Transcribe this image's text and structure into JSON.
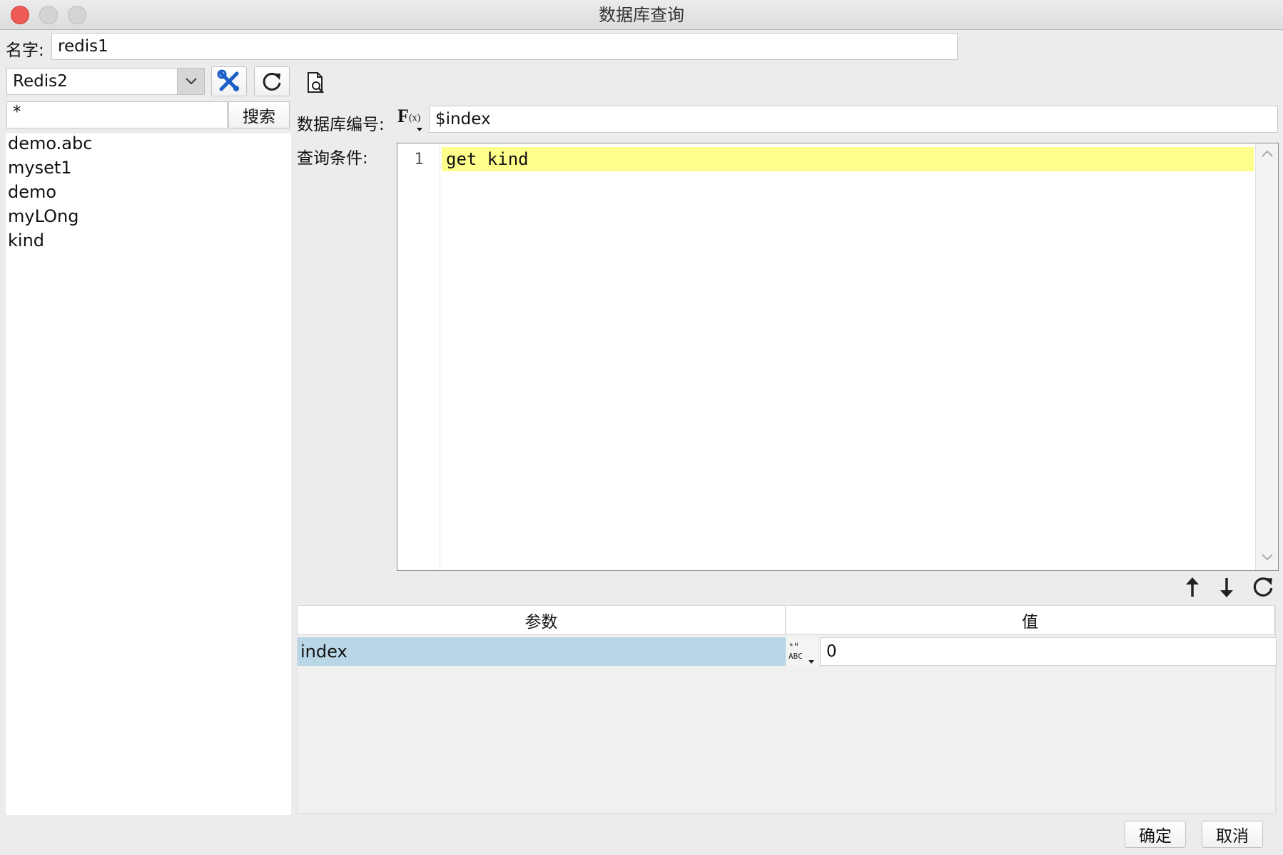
{
  "window": {
    "title": "数据库查询"
  },
  "name_row": {
    "label": "名字:",
    "value": "redis1"
  },
  "connection": {
    "selected": "Redis2"
  },
  "search": {
    "value": "*",
    "button": "搜索"
  },
  "key_list": [
    "demo.abc",
    "myset1",
    "demo",
    "myLOng",
    "kind"
  ],
  "db_index": {
    "label": "数据库编号:",
    "value": "$index"
  },
  "query": {
    "label": "查询条件:",
    "line_number": "1",
    "code": "get kind"
  },
  "params": {
    "headers": [
      "参数",
      "值"
    ],
    "rows": [
      {
        "name": "index",
        "value": "0"
      }
    ]
  },
  "footer": {
    "ok": "确定",
    "cancel": "取消"
  },
  "colors": {
    "accent_blue": "#1a5ec8",
    "highlight_yellow": "#ffff8c",
    "selection_blue": "#b8d6e6"
  },
  "icons": [
    "settings-tools-icon",
    "refresh-icon",
    "preview-document-icon",
    "function-fx-icon",
    "move-up-icon",
    "move-down-icon",
    "abc-type-icon"
  ]
}
